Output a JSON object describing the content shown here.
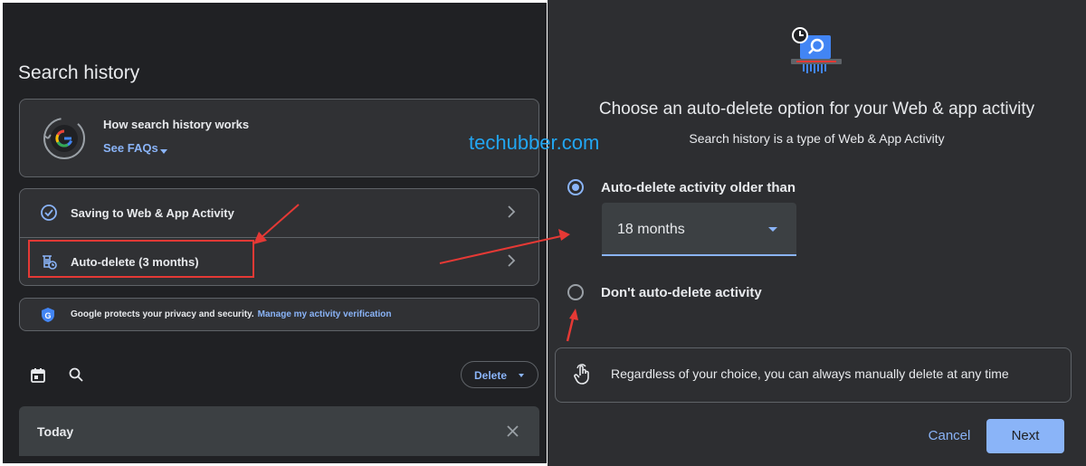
{
  "left_panel": {
    "title": "Search history",
    "how_card": {
      "title": "How search history works",
      "faq_link": "See FAQs"
    },
    "settings": [
      {
        "label": "Saving to Web & App Activity",
        "icon": "check-circle-icon"
      },
      {
        "label": "Auto-delete (3 months)",
        "icon": "auto-delete-icon"
      }
    ],
    "privacy": {
      "text": "Google protects your privacy and security.",
      "link": "Manage my activity verification"
    },
    "toolbar": {
      "delete_label": "Delete"
    },
    "today_label": "Today"
  },
  "watermark": "techubber.com",
  "dialog": {
    "title": "Choose an auto-delete option for your Web & app activity",
    "subtitle": "Search history is a type of Web & App Activity",
    "option_auto_delete": "Auto-delete activity older than",
    "select_value": "18 months",
    "option_dont": "Don't auto-delete activity",
    "note": "Regardless of your choice, you can always manually delete at any time",
    "cancel_label": "Cancel",
    "next_label": "Next"
  },
  "colors": {
    "accent": "#8ab4f8",
    "annotation_red": "#e53935",
    "watermark": "#22a6f2",
    "left_bg": "#202124",
    "right_bg": "#2d2e31"
  }
}
